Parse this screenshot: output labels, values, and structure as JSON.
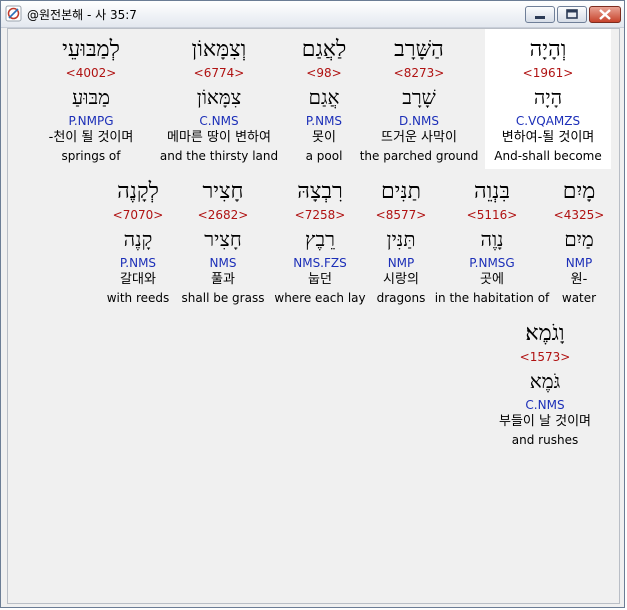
{
  "window": {
    "title": "@원전본해 - 사 35:7",
    "icon": "app-icon",
    "controls": [
      "minimize-icon",
      "maximize-icon",
      "close-icon"
    ]
  },
  "words": [
    {
      "hebrew": "וְהָיָה",
      "strong": "<1961>",
      "lemma": "הָיָה",
      "morph": "C.VQAMZS",
      "korean": "변하여-될 것이며",
      "english": "And-shall become"
    },
    {
      "hebrew": "הַשָּׁרָב",
      "strong": "<8273>",
      "lemma": "שָׁרָב",
      "morph": "D.NMS",
      "korean": "뜨거운 사막이",
      "english": "the parched ground"
    },
    {
      "hebrew": "לַאֲגַם",
      "strong": "<98>",
      "lemma": "אֲגַם",
      "morph": "P.NMS",
      "korean": "못이",
      "english": "a pool"
    },
    {
      "hebrew": "וְצִמָּאוֹן",
      "strong": "<6774>",
      "lemma": "צִמָּאוֹן",
      "morph": "C.NMS",
      "korean": "메마른 땅이 변하여",
      "english": "and the thirsty land"
    },
    {
      "hebrew": "לְמַבּוּעֵי",
      "strong": "<4002>",
      "lemma": "מַבּוּעַ",
      "morph": "P.NMPG",
      "korean": "-천이 될 것이며",
      "english": "springs of"
    },
    {
      "hebrew": "מָיִם",
      "strong": "<4325>",
      "lemma": "מַיִם",
      "morph": "NMP",
      "korean": "원-",
      "english": "water"
    },
    {
      "hebrew": "בִּנְוֵה",
      "strong": "<5116>",
      "lemma": "נָוֶה",
      "morph": "P.NMSG",
      "korean": "곳에",
      "english": "in the habitation of"
    },
    {
      "hebrew": "תַנִּים",
      "strong": "<8577>",
      "lemma": "תַּנִּין",
      "morph": "NMP",
      "korean": "시랑의",
      "english": "dragons"
    },
    {
      "hebrew": "רִבְצָהּ",
      "strong": "<7258>",
      "lemma": "רֵבֶץ",
      "morph": "NMS.FZS",
      "korean": "눕던",
      "english": "where each lay"
    },
    {
      "hebrew": "חָצִיר",
      "strong": "<2682>",
      "lemma": "חָצִיר",
      "morph": "NMS",
      "korean": "풀과",
      "english": "shall be grass"
    },
    {
      "hebrew": "לְקָנֶה",
      "strong": "<7070>",
      "lemma": "קָנֶה",
      "morph": "P.NMS",
      "korean": "갈대와",
      "english": "with reeds"
    },
    {
      "hebrew": "וָגֹמֶא׃",
      "strong": "<1573>",
      "lemma": "גֹּמֶא",
      "morph": "C.NMS",
      "korean": "부들이 날 것이며",
      "english": "and rushes"
    }
  ]
}
